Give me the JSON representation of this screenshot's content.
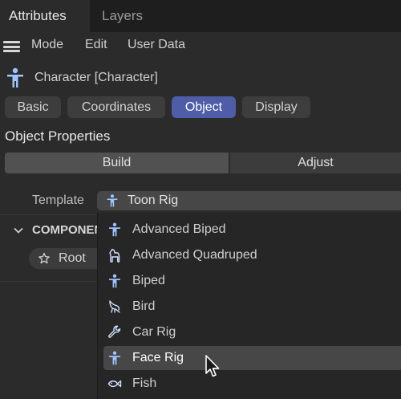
{
  "tabs": [
    {
      "label": "Attributes",
      "active": true
    },
    {
      "label": "Layers",
      "active": false
    }
  ],
  "menu": {
    "icon": "hamburger-icon",
    "items": [
      "Mode",
      "Edit",
      "User Data"
    ]
  },
  "object": {
    "icon": "character-icon",
    "title": "Character [Character]"
  },
  "attribute_tabs": [
    {
      "label": "Basic",
      "active": false
    },
    {
      "label": "Coordinates",
      "active": false
    },
    {
      "label": "Object",
      "active": true
    },
    {
      "label": "Display",
      "active": false
    }
  ],
  "section": {
    "title": "Object Properties"
  },
  "segments": {
    "build": "Build",
    "adjust": "Adjust",
    "selected": "Build"
  },
  "template": {
    "label": "Template",
    "value": "Toon Rig",
    "icon": "character-icon"
  },
  "components": {
    "label": "COMPONENTS",
    "root": "Root",
    "root_icon": "star-outline-icon"
  },
  "dropdown": {
    "items": [
      {
        "label": "Advanced Biped",
        "icon": "biped-icon"
      },
      {
        "label": "Advanced Quadruped",
        "icon": "quadruped-icon"
      },
      {
        "label": "Biped",
        "icon": "biped-icon"
      },
      {
        "label": "Bird",
        "icon": "bird-icon"
      },
      {
        "label": "Car Rig",
        "icon": "wrench-icon"
      },
      {
        "label": "Face Rig",
        "icon": "biped-icon",
        "hover": true
      },
      {
        "label": "Fish",
        "icon": "fish-icon"
      }
    ]
  },
  "colors": {
    "accent": "#4f5da8",
    "icon_blue": "#9fc3ff",
    "background": "#2b2b2b"
  }
}
